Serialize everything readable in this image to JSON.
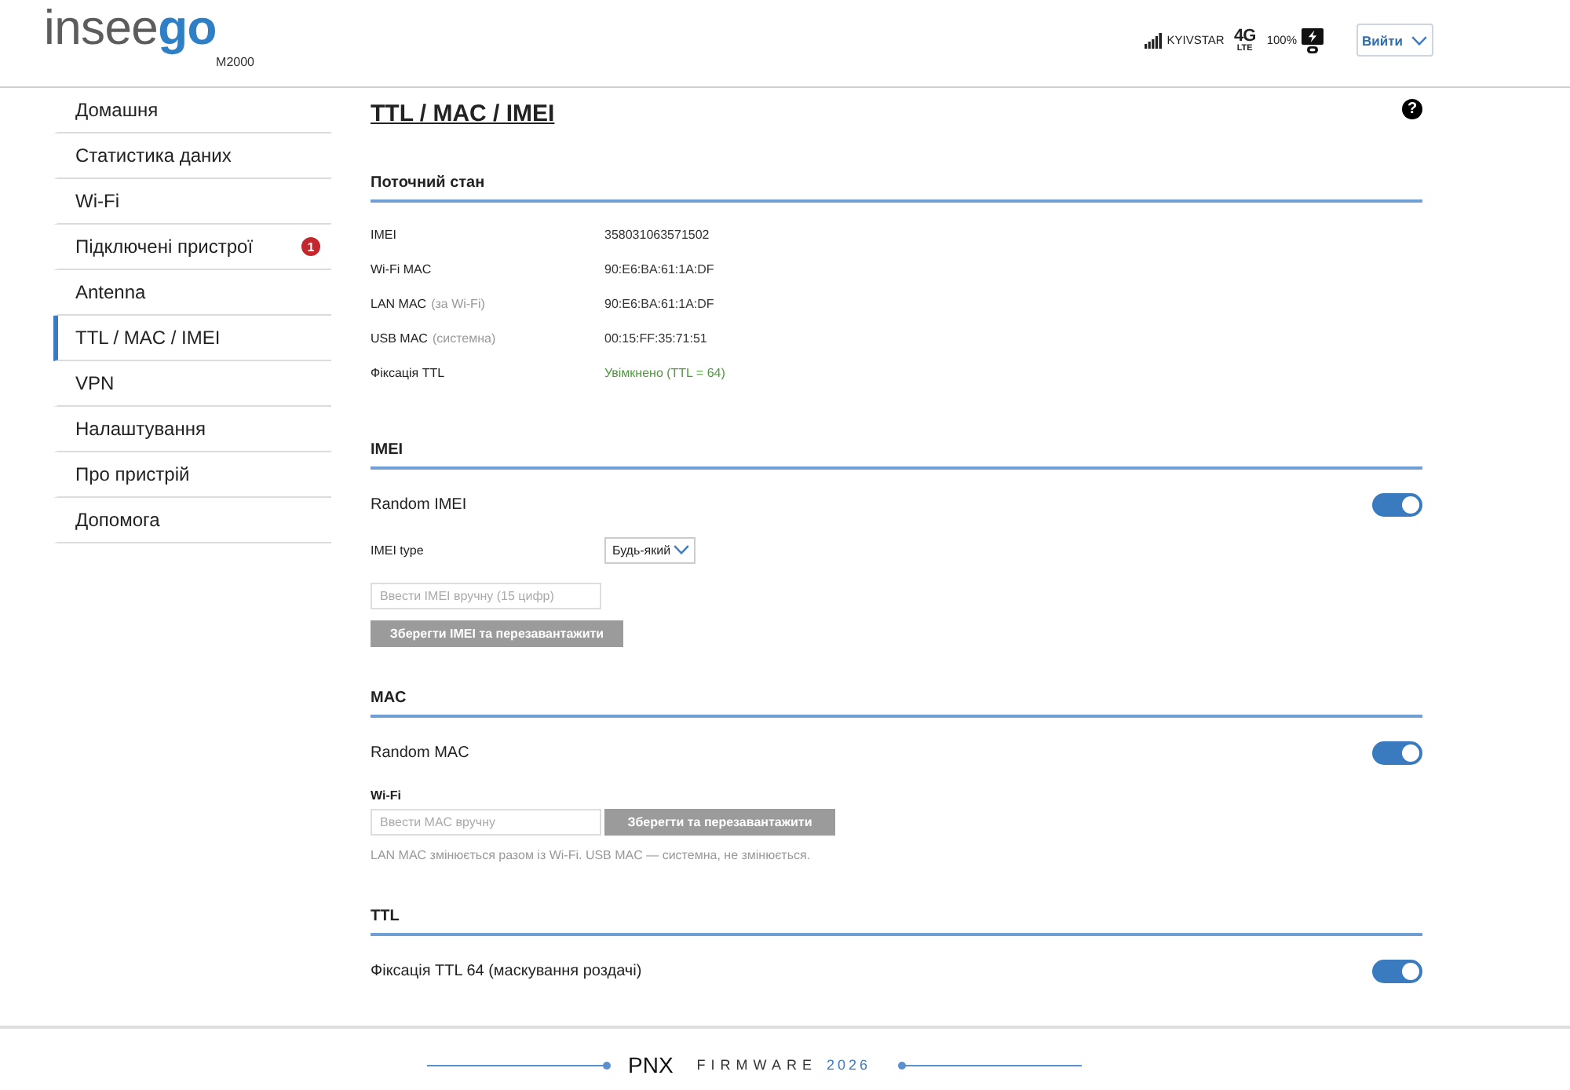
{
  "header": {
    "logo": "insee**go**",
    "model": "M2000",
    "status": {
      "carrier": "KYIVSTAR",
      "network": "4G",
      "network_sub": "LTE",
      "battery": "100%"
    },
    "logout_button": "Вийти"
  },
  "sidebar": {
    "items": [
      {
        "label": "Домашня",
        "selected": false
      },
      {
        "label": "Статистика даних",
        "selected": false
      },
      {
        "label": "Wi-Fi",
        "selected": false
      },
      {
        "label": "Підключені пристрої",
        "selected": false,
        "badge": "1"
      },
      {
        "label": "Antenna",
        "selected": false
      },
      {
        "label": "TTL / MAC / IMEI",
        "selected": true
      },
      {
        "label": "VPN",
        "selected": false
      },
      {
        "label": "Налаштування",
        "selected": false
      },
      {
        "label": "Про пристрій",
        "selected": false
      },
      {
        "label": "Допомога",
        "selected": false
      }
    ]
  },
  "page": {
    "title": "TTL / MAC / IMEI",
    "help_button": "?"
  },
  "current_state": {
    "title": "Поточний стан",
    "rows": [
      {
        "label": "IMEI",
        "value": "358031063571502",
        "color": "#333333"
      },
      {
        "label": "Wi-Fi MAC",
        "value": "90:E6:BA:61:1A:DF",
        "color": "#333333"
      },
      {
        "label": "LAN MAC",
        "note": "(за Wi-Fi)",
        "value": "90:E6:BA:61:1A:DF",
        "color": "#333333"
      },
      {
        "label": "USB MAC",
        "note": "(системна)",
        "value": "00:15:FF:35:71:51",
        "color": "#333333"
      },
      {
        "label": "Фіксація TTL",
        "value": "Увімкнено (TTL = 64)",
        "color": "#4e9a3f"
      }
    ]
  },
  "imei": {
    "title": "IMEI",
    "random": {
      "label": "Random IMEI",
      "on": true
    },
    "type": {
      "label": "IMEI type",
      "value": "Будь-який"
    },
    "manual_input": {
      "placeholder": "Ввести IMEI вручну (15 цифр)"
    },
    "save_button": "Зберегти IMEI та перезавантажити"
  },
  "mac": {
    "title": "MAC",
    "random": {
      "label": "Random MAC",
      "on": true
    },
    "wifi_label": "Wi-Fi",
    "manual_input": {
      "placeholder": "Ввести MAC вручну"
    },
    "save_button": "Зберегти та перезавантажити",
    "note": "LAN MAC змінюється разом із Wi-Fi. USB MAC — системна, не змінюється."
  },
  "ttl": {
    "title": "TTL",
    "fix": {
      "label": "Фіксація TTL 64 (маскування роздачі)",
      "on": true
    }
  },
  "footer": {
    "brand": "PNX",
    "label": "FIRMWARE",
    "year": "2026"
  }
}
